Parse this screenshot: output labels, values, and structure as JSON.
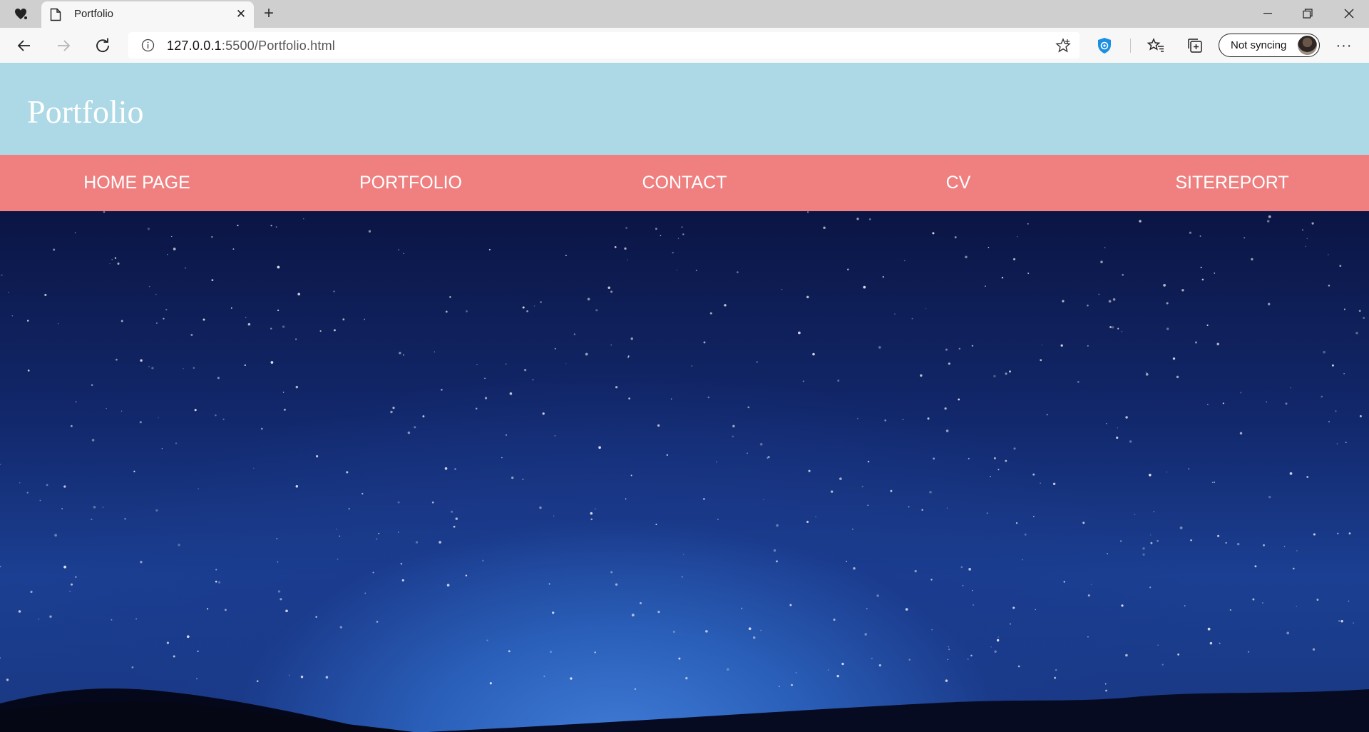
{
  "browser": {
    "tab": {
      "title": "Portfolio"
    },
    "address": {
      "host": "127.0.0.1",
      "rest": ":5500/Portfolio.html"
    },
    "profile": {
      "label": "Not syncing"
    },
    "icons": [
      "favorites-heart-icon",
      "page-icon",
      "close-icon",
      "plus-icon",
      "minimize-icon",
      "restore-icon",
      "window-close-icon",
      "back-icon",
      "forward-icon",
      "refresh-icon",
      "info-icon",
      "star-icon",
      "shield-icon",
      "favorites-icon",
      "collections-icon",
      "more-icon"
    ]
  },
  "site": {
    "title": "Portfolio",
    "header_color": "#add8e6",
    "nav_color": "#f08080",
    "nav": [
      {
        "label": "HOME PAGE"
      },
      {
        "label": "PORTFOLIO"
      },
      {
        "label": "CONTACT"
      },
      {
        "label": "CV"
      },
      {
        "label": "SITEREPORT"
      }
    ],
    "hero": {
      "alt": "starry-night-sky-image"
    }
  }
}
